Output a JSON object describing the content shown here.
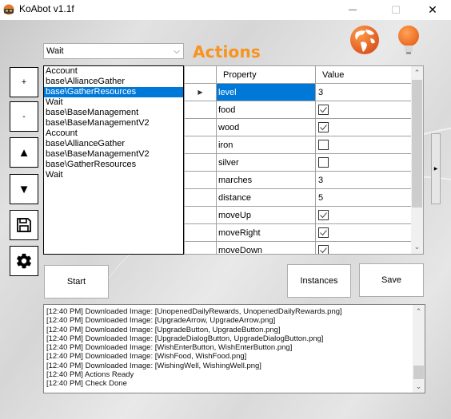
{
  "window": {
    "title": "KoAbot v1.1f",
    "minimize_glyph": "—",
    "maximize_glyph": "☐",
    "close_glyph": "✕"
  },
  "colors": {
    "accent_orange": "#f7931e",
    "selection_blue": "#0078d7"
  },
  "actions_combo": {
    "selected": "Wait",
    "arrow": "⌵"
  },
  "actions_title": "Actions",
  "side_buttons": {
    "add": "+",
    "remove": "-",
    "move_up": "▲",
    "move_down": "▼"
  },
  "action_list": {
    "items": [
      "Account",
      "base\\AllianceGather",
      "base\\GatherResources",
      "Wait",
      "base\\BaseManagement",
      "base\\BaseManagementV2",
      "Account",
      "base\\AllianceGather",
      "base\\BaseManagementV2",
      "base\\GatherResources",
      "Wait"
    ],
    "selected_index": 2
  },
  "property_grid": {
    "headers": {
      "property": "Property",
      "value": "Value"
    },
    "rows": [
      {
        "property": "level",
        "type": "text",
        "value": "3",
        "selected": true
      },
      {
        "property": "food",
        "type": "checkbox",
        "checked": true
      },
      {
        "property": "wood",
        "type": "checkbox",
        "checked": true
      },
      {
        "property": "iron",
        "type": "checkbox",
        "checked": false
      },
      {
        "property": "silver",
        "type": "checkbox",
        "checked": false
      },
      {
        "property": "marches",
        "type": "text",
        "value": "3"
      },
      {
        "property": "distance",
        "type": "text",
        "value": "5"
      },
      {
        "property": "moveUp",
        "type": "checkbox",
        "checked": true
      },
      {
        "property": "moveRight",
        "type": "checkbox",
        "checked": true
      },
      {
        "property": "moveDown",
        "type": "checkbox",
        "checked": true
      }
    ],
    "scroll_up": "⌃",
    "scroll_down": "⌄"
  },
  "expand_panel_glyph": "▶",
  "buttons": {
    "start": "Start",
    "instances": "Instances",
    "save": "Save"
  },
  "log": {
    "lines": [
      "[12:40 PM] Downloaded Image: [UnopenedDailyRewards, UnopenedDailyRewards.png]",
      "[12:40 PM] Downloaded Image: [UpgradeArrow, UpgradeArrow.png]",
      "[12:40 PM] Downloaded Image: [UpgradeButton, UpgradeButton.png]",
      "[12:40 PM] Downloaded Image: [UpgradeDialogButton, UpgradeDialogButton.png]",
      "[12:40 PM] Downloaded Image: [WishEnterButton, WishEnterButton.png]",
      "[12:40 PM] Downloaded Image: [WishFood, WishFood.png]",
      "[12:40 PM] Downloaded Image: [WishingWell, WishingWell.png]",
      "[12:40 PM] Actions Ready",
      "[12:40 PM] Check Done"
    ],
    "scroll_up": "⌃",
    "scroll_down": "⌄"
  }
}
